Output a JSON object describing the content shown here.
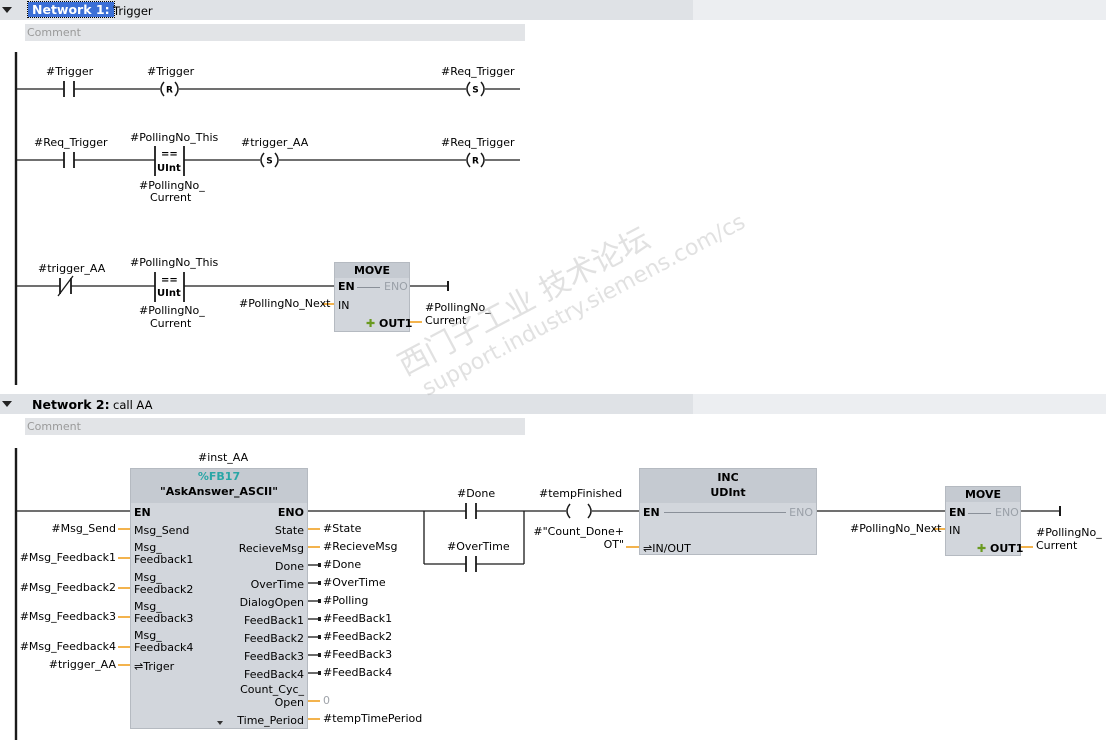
{
  "colors": {
    "rail": "#1a1a1a",
    "wire": "#1a1a1a",
    "pin_stub": "#f0a020",
    "header": "#dfe2e6",
    "block": "#d2d6dc",
    "fb_number": "#2aa6a6",
    "selection": "#3b6fd6"
  },
  "network1": {
    "title": "Network 1:",
    "desc": "Trigger",
    "comment": "Comment",
    "rung1": {
      "contact": "#Trigger",
      "reset_coil": "#Trigger",
      "set_coil": "#Req_Trigger",
      "r_letter": "R",
      "s_letter": "S"
    },
    "rung2": {
      "contact": "#Req_Trigger",
      "cmp_top": "#PollingNo_This",
      "cmp_op": "==",
      "cmp_type": "UInt",
      "cmp_bot1": "#PollingNo_",
      "cmp_bot2": "Current",
      "set_coil": "#trigger_AA",
      "reset_coil": "#Req_Trigger",
      "s_letter": "S",
      "r_letter": "R"
    },
    "rung3": {
      "contact": "#trigger_AA",
      "cmp_top": "#PollingNo_This",
      "cmp_op": "==",
      "cmp_type": "UInt",
      "cmp_bot1": "#PollingNo_",
      "cmp_bot2": "Current",
      "move": {
        "title": "MOVE",
        "en": "EN",
        "eno": "ENO",
        "in": "IN",
        "out": "OUT1",
        "in_var": "#PollingNo_Next",
        "out_var1": "#PollingNo_",
        "out_var2": "Current"
      }
    }
  },
  "network2": {
    "title": "Network 2:",
    "desc": "call AA",
    "comment": "Comment",
    "fb": {
      "instance": "#inst_AA",
      "number": "%FB17",
      "name": "\"AskAnswer_ASCII\"",
      "en": "EN",
      "eno": "ENO",
      "inputs": [
        {
          "pin1": "Msg_Send",
          "pin2": "",
          "var": "#Msg_Send"
        },
        {
          "pin1": "Msg_",
          "pin2": "Feedback1",
          "var": "#Msg_Feedback1"
        },
        {
          "pin1": "Msg_",
          "pin2": "Feedback2",
          "var": "#Msg_Feedback2"
        },
        {
          "pin1": "Msg_",
          "pin2": "Feedback3",
          "var": "#Msg_Feedback3"
        },
        {
          "pin1": "Msg_",
          "pin2": "Feedback4",
          "var": "#Msg_Feedback4"
        },
        {
          "pin1": "⇌Triger",
          "pin2": "",
          "var": "#trigger_AA"
        }
      ],
      "outputs": [
        {
          "pin1": "State",
          "pin2": "",
          "var": "#State"
        },
        {
          "pin1": "RecieveMsg",
          "pin2": "",
          "var": "#RecieveMsg"
        },
        {
          "pin1": "Done",
          "pin2": "",
          "var": "#Done"
        },
        {
          "pin1": "OverTime",
          "pin2": "",
          "var": "#OverTime"
        },
        {
          "pin1": "DialogOpen",
          "pin2": "",
          "var": "#Polling"
        },
        {
          "pin1": "FeedBack1",
          "pin2": "",
          "var": "#FeedBack1"
        },
        {
          "pin1": "FeedBack2",
          "pin2": "",
          "var": "#FeedBack2"
        },
        {
          "pin1": "FeedBack3",
          "pin2": "",
          "var": "#FeedBack3"
        },
        {
          "pin1": "FeedBack4",
          "pin2": "",
          "var": "#FeedBack4"
        },
        {
          "pin1": "Count_Cyc_",
          "pin2": "Open",
          "var": "0"
        },
        {
          "pin1": "Time_Period",
          "pin2": "",
          "var": "#tempTimePeriod"
        }
      ]
    },
    "contact_done": "#Done",
    "contact_overtime": "#OverTime",
    "coil": "#tempFinished",
    "inc": {
      "title": "INC",
      "type": "UDInt",
      "en": "EN",
      "eno": "ENO",
      "inout": "⇌IN/OUT",
      "var1": "#\"Count_Done+",
      "var2": "OT\""
    },
    "move": {
      "title": "MOVE",
      "en": "EN",
      "eno": "ENO",
      "in": "IN",
      "out": "OUT1",
      "in_var": "#PollingNo_Next",
      "out_var1": "#PollingNo_",
      "out_var2": "Current"
    }
  },
  "watermark": {
    "line1": "西门子工业  技术论坛",
    "line2": "support.industry.siemens.com/cs"
  }
}
